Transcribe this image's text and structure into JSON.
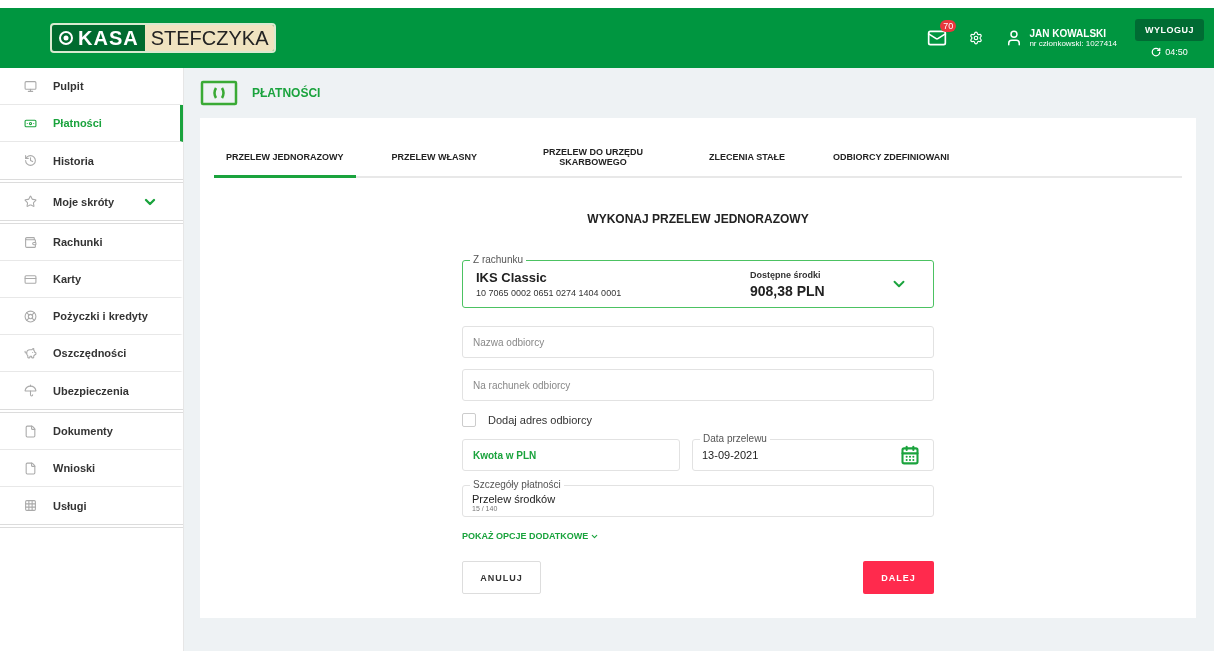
{
  "header": {
    "logo": {
      "left": "KASA",
      "right": "STEFCZYKA"
    },
    "messages_badge": "70",
    "user": {
      "name": "JAN KOWALSKI",
      "member": "nr członkowski: 1027414"
    },
    "logout": "WYLOGUJ",
    "session_time": "04:50"
  },
  "sidebar": {
    "groups": [
      [
        {
          "label": "Pulpit",
          "selected": false,
          "kind": "link"
        },
        {
          "label": "Płatności",
          "selected": true,
          "kind": "link"
        },
        {
          "label": "Historia",
          "selected": false,
          "kind": "link"
        }
      ],
      [
        {
          "label": "Moje skróty",
          "selected": false,
          "kind": "expandable"
        }
      ],
      [
        {
          "label": "Rachunki",
          "selected": false,
          "kind": "link"
        },
        {
          "label": "Karty",
          "selected": false,
          "kind": "link"
        },
        {
          "label": "Pożyczki i kredyty",
          "selected": false,
          "kind": "link"
        },
        {
          "label": "Oszczędności",
          "selected": false,
          "kind": "link"
        },
        {
          "label": "Ubezpieczenia",
          "selected": false,
          "kind": "link"
        }
      ],
      [
        {
          "label": "Dokumenty",
          "selected": false,
          "kind": "link"
        },
        {
          "label": "Wnioski",
          "selected": false,
          "kind": "link"
        },
        {
          "label": "Usługi",
          "selected": false,
          "kind": "link"
        }
      ]
    ]
  },
  "page_title": "PŁATNOŚCI",
  "tabs": [
    {
      "label": "PRZELEW JEDNORAZOWY",
      "selected": true
    },
    {
      "label": "PRZELEW WŁASNY",
      "selected": false
    },
    {
      "label": "PRZELEW DO URZĘDU SKARBOWEGO",
      "selected": false
    },
    {
      "label": "ZLECENIA STAŁE",
      "selected": false
    },
    {
      "label": "ODBIORCY ZDEFINIOWANI",
      "selected": false
    }
  ],
  "form": {
    "title": "WYKONAJ PRZELEW JEDNORAZOWY",
    "account": {
      "label": "Z rachunku",
      "name": "IKS Classic",
      "number": "10 7065 0002 0651 0274 1404 0001",
      "funds_label": "Dostępne środki",
      "funds": "908,38 PLN"
    },
    "recipient_name": {
      "placeholder": "Nazwa odbiorcy"
    },
    "recipient_account": {
      "placeholder": "Na rachunek odbiorcy"
    },
    "add_address": {
      "label": "Dodaj adres odbiorcy",
      "checked": false
    },
    "amount": {
      "placeholder": "Kwota w PLN"
    },
    "date": {
      "label": "Data przelewu",
      "value": "13-09-2021"
    },
    "details": {
      "label": "Szczegóły płatności",
      "value": "Przelew środków",
      "counter": "15 / 140"
    },
    "more_options": "POKAŻ OPCJE DODATKOWE",
    "cancel": "ANULUJ",
    "next": "DALEJ"
  }
}
